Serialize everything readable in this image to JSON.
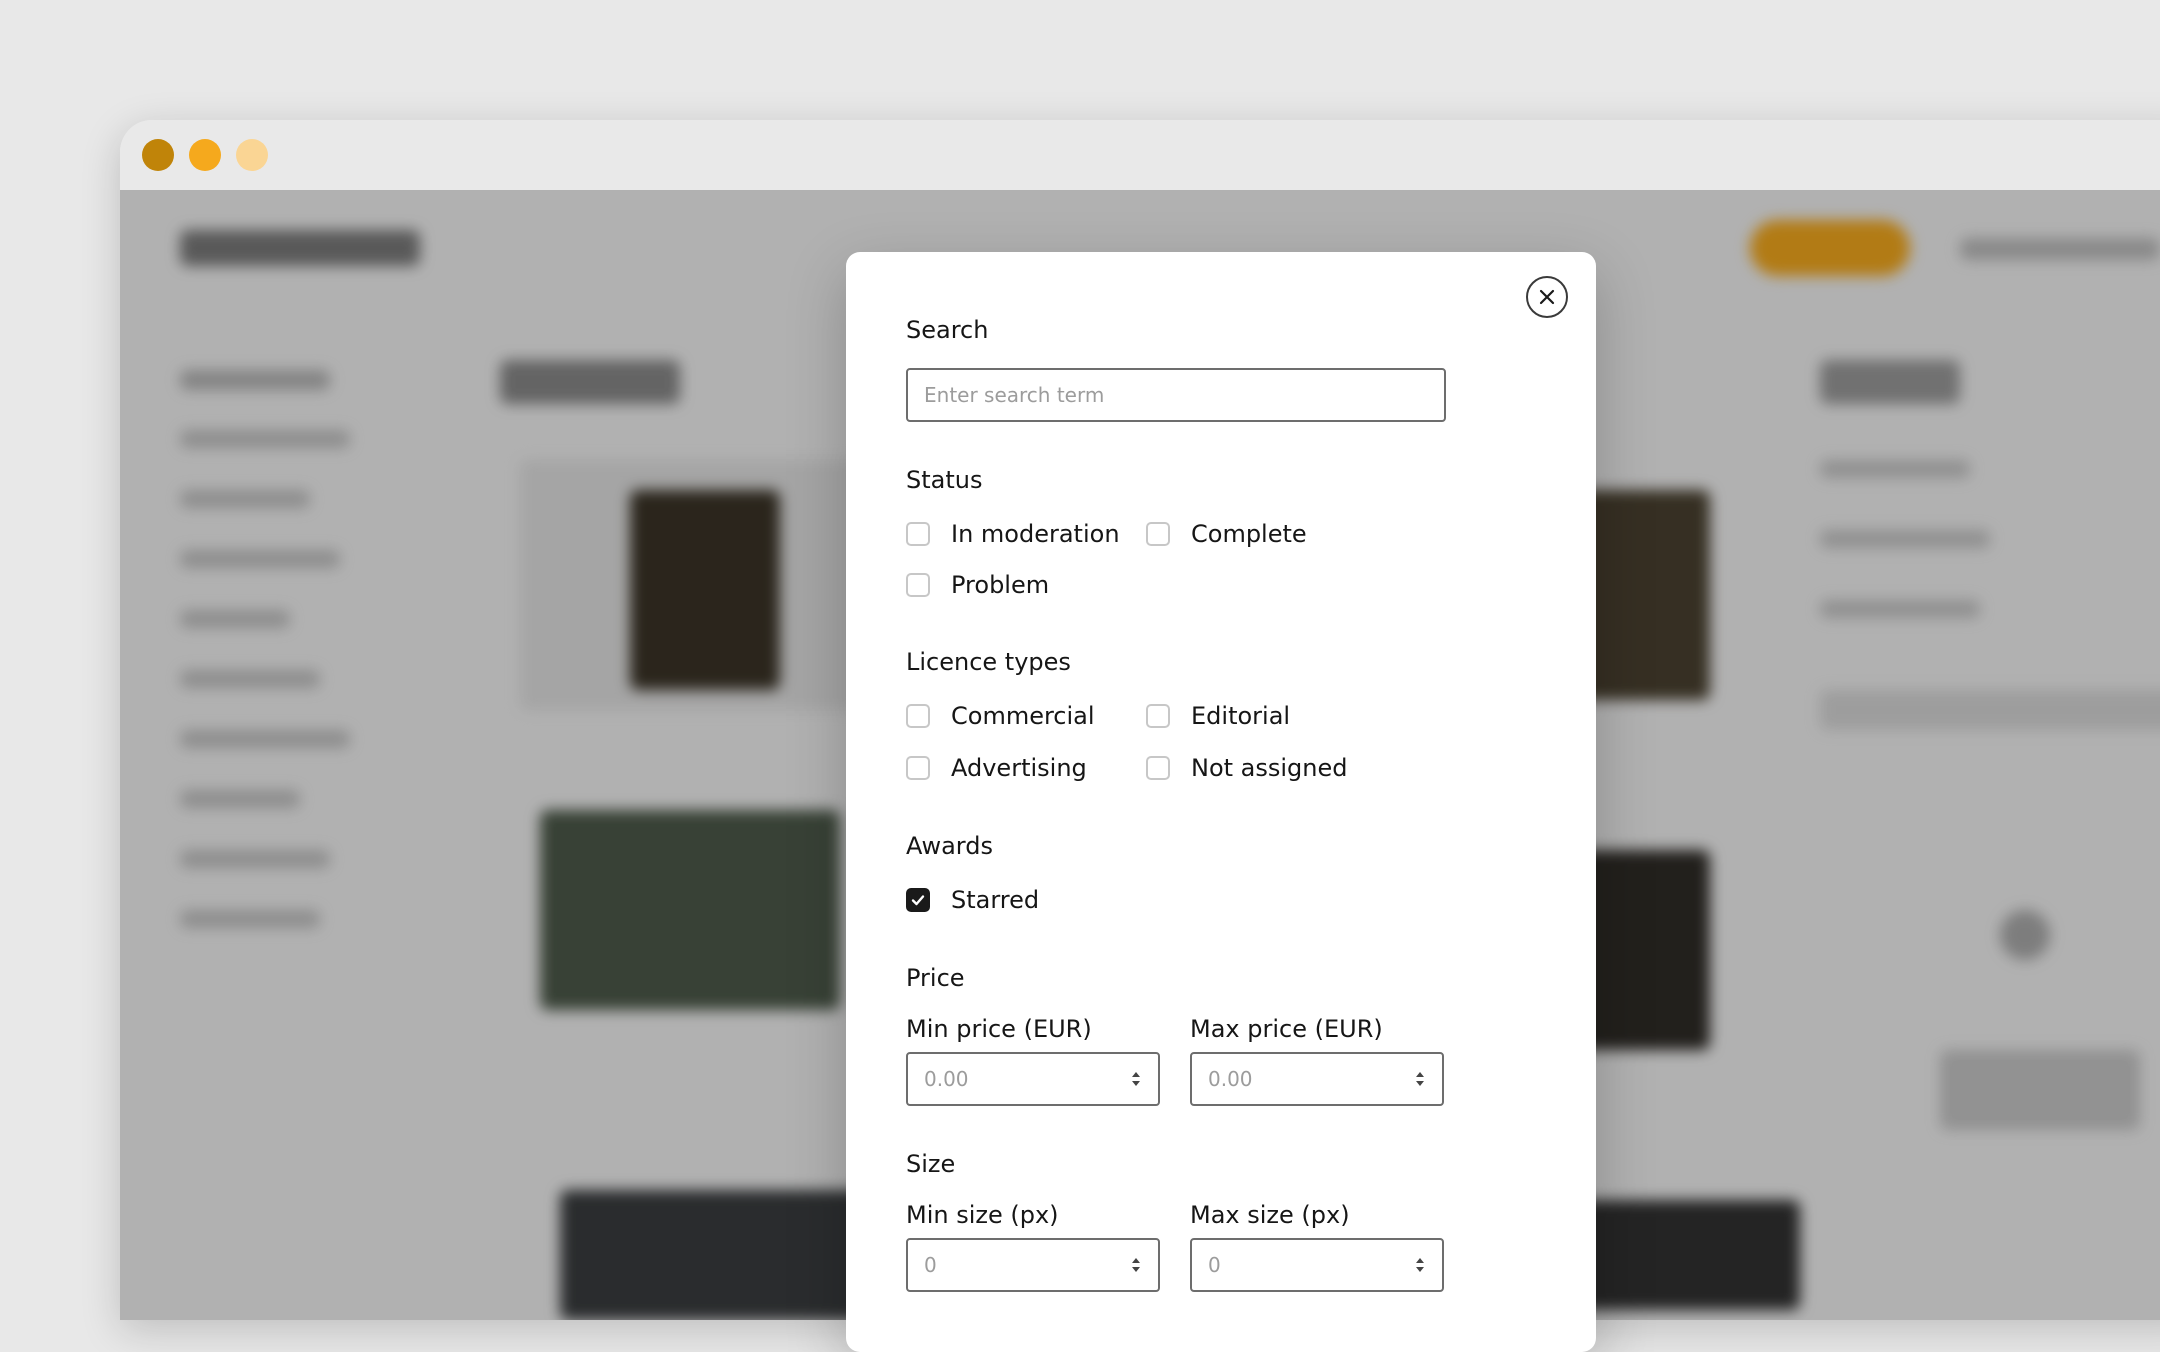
{
  "window": {
    "controls": [
      "close",
      "minimize",
      "maximize"
    ],
    "colors": {
      "close": "#c08409",
      "minimize": "#f5a91d",
      "maximize": "#fad594"
    }
  },
  "filter_modal": {
    "close_icon": "close-icon",
    "search": {
      "label": "Search",
      "placeholder": "Enter search term",
      "value": ""
    },
    "status": {
      "label": "Status",
      "options": [
        {
          "label": "In moderation",
          "checked": false
        },
        {
          "label": "Complete",
          "checked": false
        },
        {
          "label": "Problem",
          "checked": false
        }
      ]
    },
    "licence_types": {
      "label": "Licence types",
      "options": [
        {
          "label": "Commercial",
          "checked": false
        },
        {
          "label": "Editorial",
          "checked": false
        },
        {
          "label": "Advertising",
          "checked": false
        },
        {
          "label": "Not assigned",
          "checked": false
        }
      ]
    },
    "awards": {
      "label": "Awards",
      "options": [
        {
          "label": "Starred",
          "checked": true
        }
      ]
    },
    "price": {
      "label": "Price",
      "min_label": "Min price (EUR)",
      "min_placeholder": "0.00",
      "max_label": "Max price (EUR)",
      "max_placeholder": "0.00"
    },
    "size": {
      "label": "Size",
      "min_label": "Min size (px)",
      "min_placeholder": "0",
      "max_label": "Max size (px)",
      "max_placeholder": "0"
    }
  },
  "colors": {
    "accent": "#f5a91d",
    "checked_box": "#1a1a1a",
    "overlay": "rgba(0,0,0,0.27)"
  }
}
